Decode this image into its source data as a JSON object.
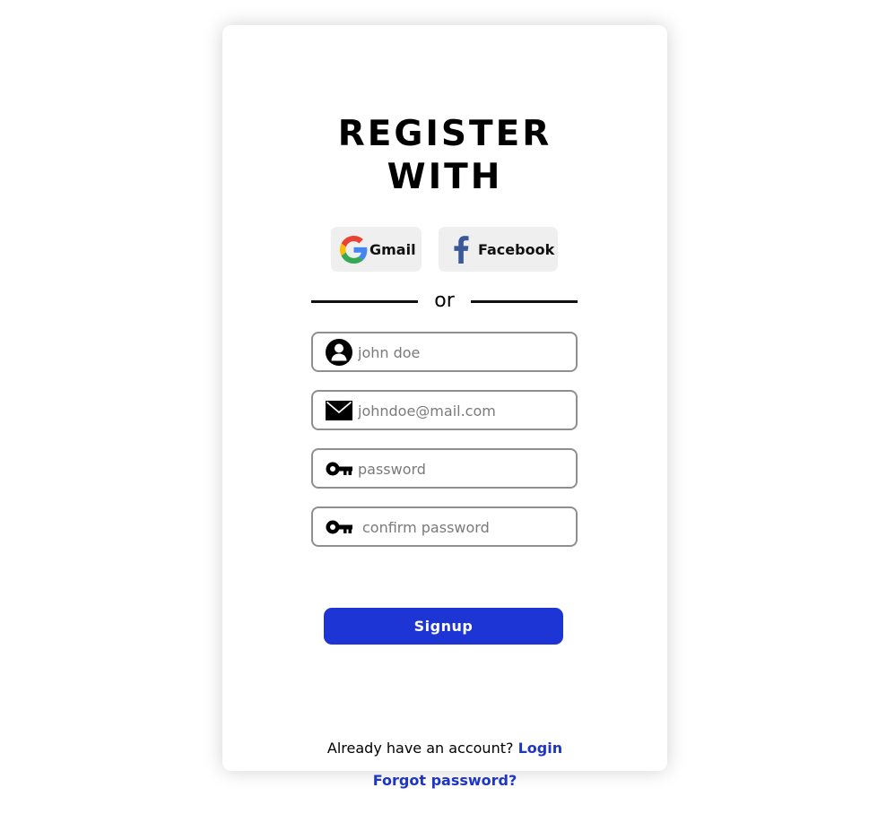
{
  "form": {
    "title_line1": "REGISTER",
    "title_line2": "WITH",
    "social": {
      "gmail_label": "Gmail",
      "facebook_label": "Facebook"
    },
    "divider_text": "or",
    "fields": {
      "name_placeholder": "john doe",
      "email_placeholder": "johndoe@mail.com",
      "password_placeholder": "password",
      "confirm_placeholder": "confirm password"
    },
    "signup_label": "Signup",
    "account_prompt": "Already have an account?",
    "login_label": "Login",
    "forgot_label": "Forgot password?"
  },
  "colors": {
    "accent": "#1e35d6",
    "link": "#1e35c9",
    "social_bg": "#efefef",
    "facebook": "#3b5998"
  },
  "icons": {
    "gmail": "google-g-icon",
    "facebook": "facebook-f-icon",
    "name": "user-circle-icon",
    "email": "envelope-icon",
    "password": "key-icon",
    "confirm": "key-icon"
  }
}
